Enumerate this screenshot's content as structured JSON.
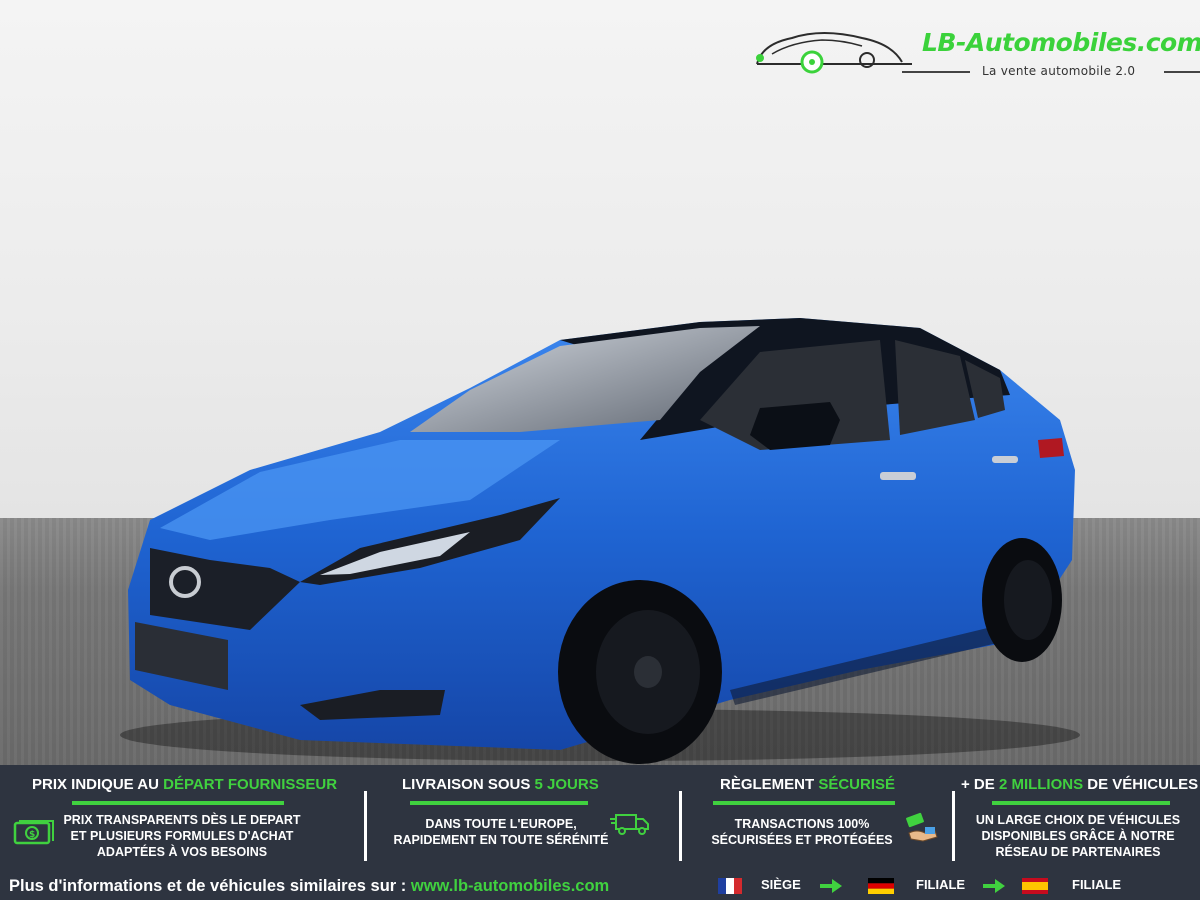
{
  "logo": {
    "brand": "LB-Automobiles.com",
    "tagline": "La vente automobile 2.0"
  },
  "banner": {
    "columns": [
      {
        "title_prefix": "PRIX INDIQUE AU ",
        "title_highlight": "DÉPART FOURNISSEUR",
        "title_suffix": "",
        "lines": [
          "PRIX TRANSPARENTS DÈS LE DEPART",
          "ET PLUSIEURS FORMULES D'ACHAT",
          "ADAPTÉES À VOS BESOINS"
        ],
        "icon": "money-icon"
      },
      {
        "title_prefix": "LIVRAISON SOUS ",
        "title_highlight": "5 JOURS",
        "title_suffix": "",
        "lines": [
          "DANS TOUTE L'EUROPE,",
          "RAPIDEMENT EN TOUTE SÉRÉNITÉ"
        ],
        "icon": "delivery-truck-icon"
      },
      {
        "title_prefix": "RÈGLEMENT ",
        "title_highlight": "SÉCURISÉ",
        "title_suffix": "",
        "lines": [
          "TRANSACTIONS 100%",
          "SÉCURISÉES ET PROTÉGÉES"
        ],
        "icon": "payment-hand-icon"
      },
      {
        "title_prefix": "+ DE ",
        "title_highlight": "2 MILLIONS",
        "title_suffix": " DE VÉHICULES",
        "lines": [
          "UN LARGE CHOIX DE VÉHICULES",
          "DISPONIBLES GRÂCE À NOTRE",
          "RÉSEAU DE PARTENAIRES"
        ],
        "icon": ""
      }
    ],
    "footer_text": "Plus d'informations et de véhicules similaires sur : ",
    "footer_url": "www.lb-automobiles.com",
    "locations": [
      {
        "flag": "france-flag-icon",
        "label": "SIÈGE"
      },
      {
        "flag": "germany-flag-icon",
        "label": "FILIALE"
      },
      {
        "flag": "spain-flag-icon",
        "label": "FILIALE"
      }
    ]
  },
  "colors": {
    "accent_green": "#40d13f",
    "banner_bg": "#2e3440",
    "car_blue": "#1f64d2"
  }
}
